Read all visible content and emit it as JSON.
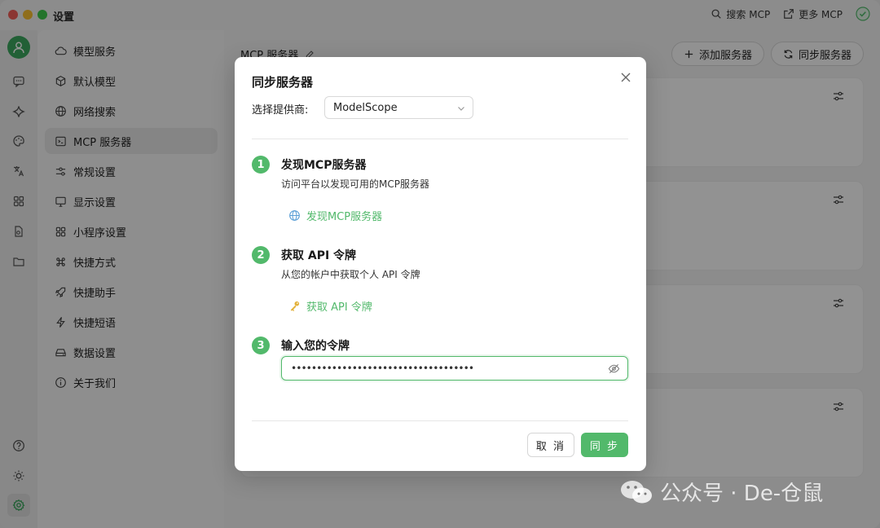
{
  "app": {
    "title": "设置"
  },
  "titlebar": {
    "search_mcp": "搜索 MCP",
    "more_mcp": "更多 MCP"
  },
  "nav": {
    "items": [
      {
        "label": "模型服务"
      },
      {
        "label": "默认模型"
      },
      {
        "label": "网络搜索"
      },
      {
        "label": "MCP 服务器"
      },
      {
        "label": "常规设置"
      },
      {
        "label": "显示设置"
      },
      {
        "label": "小程序设置"
      },
      {
        "label": "快捷方式"
      },
      {
        "label": "快捷助手"
      },
      {
        "label": "快捷短语"
      },
      {
        "label": "数据设置"
      },
      {
        "label": "关于我们"
      }
    ]
  },
  "main": {
    "title": "MCP 服务器",
    "add_button": "添加服务器",
    "sync_button": "同步服务器"
  },
  "modal": {
    "title": "同步服务器",
    "provider_label": "选择提供商:",
    "provider_value": "ModelScope",
    "steps": [
      {
        "num": "1",
        "title": "发现MCP服务器",
        "desc": "访问平台以发现可用的MCP服务器",
        "link": "发现MCP服务器"
      },
      {
        "num": "2",
        "title": "获取 API 令牌",
        "desc": "从您的帐户中获取个人 API 令牌",
        "link": "获取 API 令牌"
      },
      {
        "num": "3",
        "title": "输入您的令牌"
      }
    ],
    "token_value": "••••••••••••••••••••••••••••••••••••",
    "cancel": "取 消",
    "sync": "同 步"
  },
  "watermark": {
    "text": "公众号 · De-仓鼠"
  },
  "colors": {
    "accent": "#52b96b",
    "avatar": "#3ba55d"
  }
}
